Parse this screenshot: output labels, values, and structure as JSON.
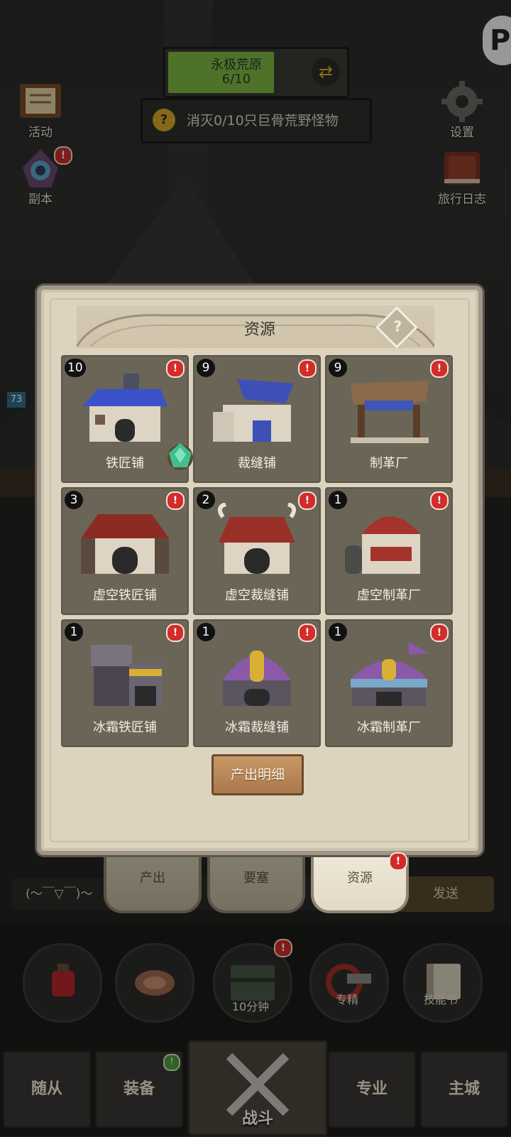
{
  "hud": {
    "quest_title": "永极荒原",
    "quest_count": "6/10",
    "quest_progress": 0.6,
    "task_text": "消灭0/10只巨骨荒野怪物",
    "task_icon": "?"
  },
  "side_left": [
    {
      "label": "活动",
      "icon": "scroll-board-icon"
    },
    {
      "label": "副本",
      "icon": "portal-icon",
      "alert": "!"
    }
  ],
  "side_right": [
    {
      "label": "设置",
      "icon": "gear-icon"
    },
    {
      "label": "旅行日志",
      "icon": "book-icon"
    }
  ],
  "panel": {
    "title": "资源",
    "help": "?",
    "detail_button": "产出明细",
    "buildings": [
      {
        "name": "铁匠铺",
        "count": "10",
        "roof": "#3a52c8",
        "wall": "#d9d1c2"
      },
      {
        "name": "裁缝铺",
        "count": "9",
        "roof": "#3f4fb8",
        "wall": "#d9d1c2"
      },
      {
        "name": "制革厂",
        "count": "9",
        "roof": "#8a6a4a",
        "wall": "#d9d1c2"
      },
      {
        "name": "虚空铁匠铺",
        "count": "3",
        "roof": "#8c2a24",
        "wall": "#d9d1c2"
      },
      {
        "name": "虚空裁缝铺",
        "count": "2",
        "roof": "#9a2f28",
        "wall": "#d9d1c2"
      },
      {
        "name": "虚空制革厂",
        "count": "1",
        "roof": "#a3332b",
        "wall": "#d9d1c2"
      },
      {
        "name": "冰霜铁匠铺",
        "count": "1",
        "roof": "#6a6570",
        "wall": "#5a5560"
      },
      {
        "name": "冰霜裁缝铺",
        "count": "1",
        "roof": "#8a5aa8",
        "wall": "#5a5560"
      },
      {
        "name": "冰霜制革厂",
        "count": "1",
        "roof": "#8a5aa8",
        "wall": "#7aa8c8"
      }
    ],
    "alert": "!"
  },
  "tabs": [
    {
      "label": "产出",
      "active": false
    },
    {
      "label": "要塞",
      "active": false
    },
    {
      "label": "资源",
      "active": true,
      "alert": "!"
    }
  ],
  "chat": {
    "text": "(～￣▽￣)～",
    "send": "发送"
  },
  "level_badge": "73",
  "actions": [
    {
      "label": "",
      "icon": "potion-icon"
    },
    {
      "label": "",
      "icon": "meat-icon"
    },
    {
      "label": "10分钟",
      "icon": "chest-icon",
      "alert": "!"
    },
    {
      "label": "专精",
      "icon": "axe-icon"
    },
    {
      "label": "技能书",
      "icon": "skill-book-icon"
    }
  ],
  "nav": [
    {
      "label": "随从"
    },
    {
      "label": "装备",
      "alert": "!"
    },
    {
      "label": "战斗"
    },
    {
      "label": "专业"
    },
    {
      "label": "主城"
    }
  ],
  "logo_letter": "P"
}
